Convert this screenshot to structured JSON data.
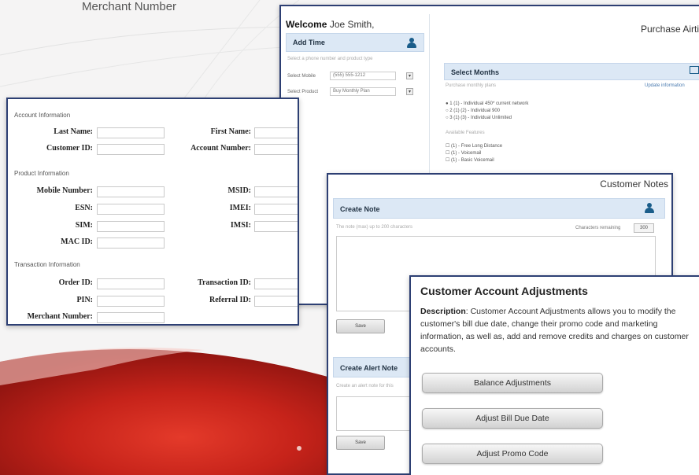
{
  "caption": "Merchant Number",
  "welcome_panel": {
    "welcome_bold": "Welcome",
    "user_name": "Joe Smith,",
    "purchase_title": "Purchase Airtim",
    "add_time": {
      "header": "Add Time",
      "hint": "Select a phone number and product type",
      "rows": [
        {
          "label": "Select Mobile",
          "value": "(555) 555-1212"
        },
        {
          "label": "Select Product",
          "value": "Buy Monthly Plan"
        }
      ]
    },
    "select_months": {
      "header": "Select Months",
      "sub_left": "Purchase monthly plans",
      "sub_right": "Update information",
      "options": [
        "1 (1) - Individual 450* current network",
        "2 (1) (2) - Individual 900",
        "3 (1) (3) - Individual Unlimited"
      ],
      "addons_label": "Available Features",
      "addons": [
        "(1) - Free Long Distance",
        "(1) - Voicemail",
        "(1) - Basic Voicemail"
      ]
    }
  },
  "account_panel": {
    "sections": [
      {
        "title": "Account Information"
      },
      {
        "title": "Product Information"
      },
      {
        "title": "Transaction Information"
      }
    ],
    "fields": {
      "last_name": "Last Name:",
      "first_name": "First Name:",
      "customer_id": "Customer ID:",
      "account_number": "Account Number:",
      "mobile_number": "Mobile Number:",
      "msid": "MSID:",
      "esn": "ESN:",
      "imei": "IMEI:",
      "sim": "SIM:",
      "imsi": "IMSI:",
      "mac_id": "MAC ID:",
      "order_id": "Order ID:",
      "transaction_id": "Transaction ID:",
      "pin": "PIN:",
      "referral_id": "Referral ID:",
      "merchant_number": "Merchant Number:"
    }
  },
  "notes_panel": {
    "title": "Customer Notes",
    "create_note": {
      "header": "Create Note",
      "hint": "The note (max) up to 200 characters",
      "remaining_label": "Characters remaining",
      "remaining_value": "300",
      "save_label": "Save"
    },
    "alert_note": {
      "header": "Create Alert Note",
      "hint": "Create an alert note for this",
      "save_label": "Save"
    }
  },
  "adjust_panel": {
    "title": "Customer Account Adjustments",
    "desc_label": "Description",
    "desc_text": ": Customer Account Adjustments allows you to modify the customer's bill due date, change their promo code and marketing information, as well as, add and remove credits and charges on customer accounts.",
    "buttons": [
      {
        "label": "Balance Adjustments"
      },
      {
        "label": "Adjust Bill Due Date"
      },
      {
        "label": "Adjust Promo Code"
      }
    ]
  }
}
